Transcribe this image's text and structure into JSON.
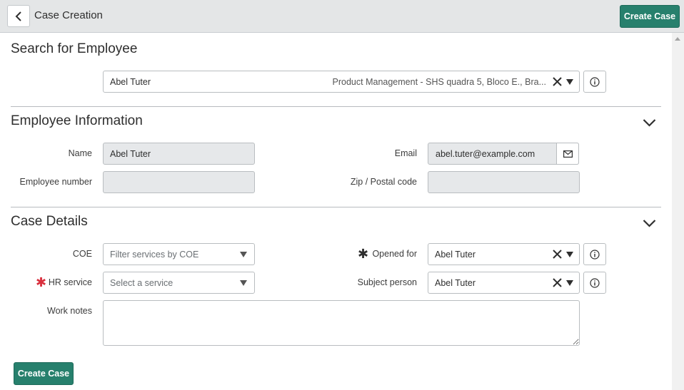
{
  "header": {
    "title": "Case Creation",
    "create_label": "Create Case"
  },
  "search": {
    "title": "Search for Employee",
    "employee_name": "Abel Tuter",
    "employee_detail": "Product Management - SHS quadra 5, Bloco E., Bra..."
  },
  "employee_info": {
    "title": "Employee Information",
    "name_label": "Name",
    "name_value": "Abel Tuter",
    "email_label": "Email",
    "email_value": "abel.tuter@example.com",
    "employee_number_label": "Employee number",
    "employee_number_value": "",
    "zip_label": "Zip / Postal code",
    "zip_value": ""
  },
  "case_details": {
    "title": "Case Details",
    "coe_label": "COE",
    "coe_placeholder": "Filter services by COE",
    "hr_service_label": "HR service",
    "hr_service_placeholder": "Select a service",
    "opened_for_label": "Opened for",
    "opened_for_value": "Abel Tuter",
    "subject_person_label": "Subject person",
    "subject_person_value": "Abel Tuter",
    "work_notes_label": "Work notes",
    "required_mark": "✱"
  },
  "footer": {
    "create_label": "Create Case"
  },
  "colors": {
    "primary": "#27806d",
    "required": "#d9303e",
    "readonly_bg": "#e6e8ea"
  },
  "icons": [
    "chevron-left-icon",
    "clear-x-icon",
    "caret-down-icon",
    "info-icon",
    "envelope-icon",
    "chevron-down-icon"
  ]
}
